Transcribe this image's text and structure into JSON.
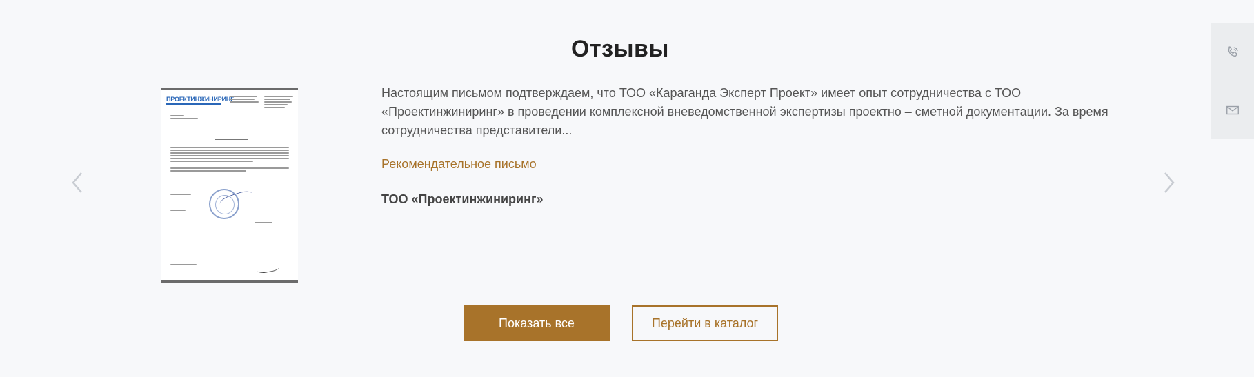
{
  "section": {
    "title": "Отзывы"
  },
  "carousel": {
    "prev_icon": "chevron-left-icon",
    "next_icon": "chevron-right-icon"
  },
  "review": {
    "document_logo": "ПРОЕКТИНЖИНИРИНГ",
    "document_heading": "Рекомендательное письмо",
    "text": "Настоящим письмом подтверждаем, что ТОО «Караганда Эксперт Проект» имеет опыт сотрудничества с ТОО «Проектинжиниринг» в проведении комплексной вневедомственной экспертизы проектно – сметной документации. За время сотрудничества представители...",
    "link": "Рекомендательное письмо",
    "author": "ТОО «Проектинжиниринг»"
  },
  "buttons": {
    "show_all": "Показать все",
    "catalog": "Перейти в каталог"
  },
  "side_panel": {
    "items": [
      {
        "icon": "phone-icon"
      },
      {
        "icon": "mail-icon"
      }
    ]
  },
  "colors": {
    "accent": "#a8732a",
    "background": "#f7f8fa",
    "title": "#222222"
  }
}
